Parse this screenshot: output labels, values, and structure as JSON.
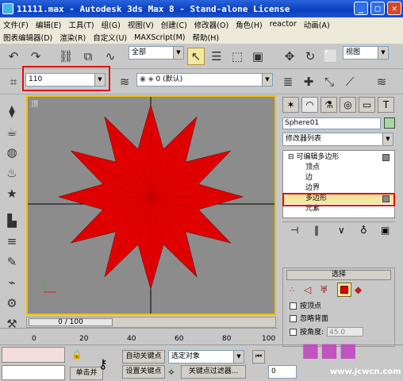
{
  "window": {
    "title": "11111.max - Autodesk 3ds Max 8 - Stand-alone License"
  },
  "menubar": {
    "row1": [
      "文件(F)",
      "编辑(E)",
      "工具(T)",
      "组(G)",
      "视图(V)",
      "创建(C)",
      "修改器(O)",
      "角色(H)",
      "reactor",
      "动画(A)"
    ],
    "row2": [
      "图表编辑器(D)",
      "渲染(R)",
      "自定义(U)",
      "MAXScript(M)",
      "帮助(H)"
    ]
  },
  "toolbar1": {
    "selection_filter": "全部",
    "coord_system": "视图"
  },
  "toolbar2": {
    "named_selection": "110",
    "layer": "0 (默认)"
  },
  "viewport": {
    "label": "顶",
    "object_color": "#e00000"
  },
  "timeline": {
    "position": "0 / 100",
    "ticks": [
      "0",
      "20",
      "40",
      "60",
      "80",
      "100"
    ]
  },
  "bottom": {
    "auto_key": "自动关键点",
    "selected_object": "选定对象",
    "set_key": "设置关键点",
    "key_filters": "关键点过滤器...",
    "frame_value": "0",
    "click_or_drag": "单击并"
  },
  "command_panel": {
    "object_name": "Sphere01",
    "object_color": "#a8d8a0",
    "modifier_list": "修改器列表",
    "stack": [
      {
        "label": "可编辑多边形",
        "level": 0
      },
      {
        "label": "顶点",
        "level": 1
      },
      {
        "label": "边",
        "level": 1
      },
      {
        "label": "边界",
        "level": 1
      },
      {
        "label": "多边形",
        "level": 1,
        "selected": true
      },
      {
        "label": "元素",
        "level": 1
      }
    ],
    "selection_rollout": {
      "title": "选择",
      "by_vertex": "按顶点",
      "ignore_backfacing": "忽略背面",
      "by_angle": "按角度:",
      "angle_value": "45.0"
    }
  },
  "watermark": {
    "text": "www.jcwcn.com"
  },
  "accent_colors": {
    "highlight_box": "#e01010",
    "viewport_border": "#f0c000"
  }
}
